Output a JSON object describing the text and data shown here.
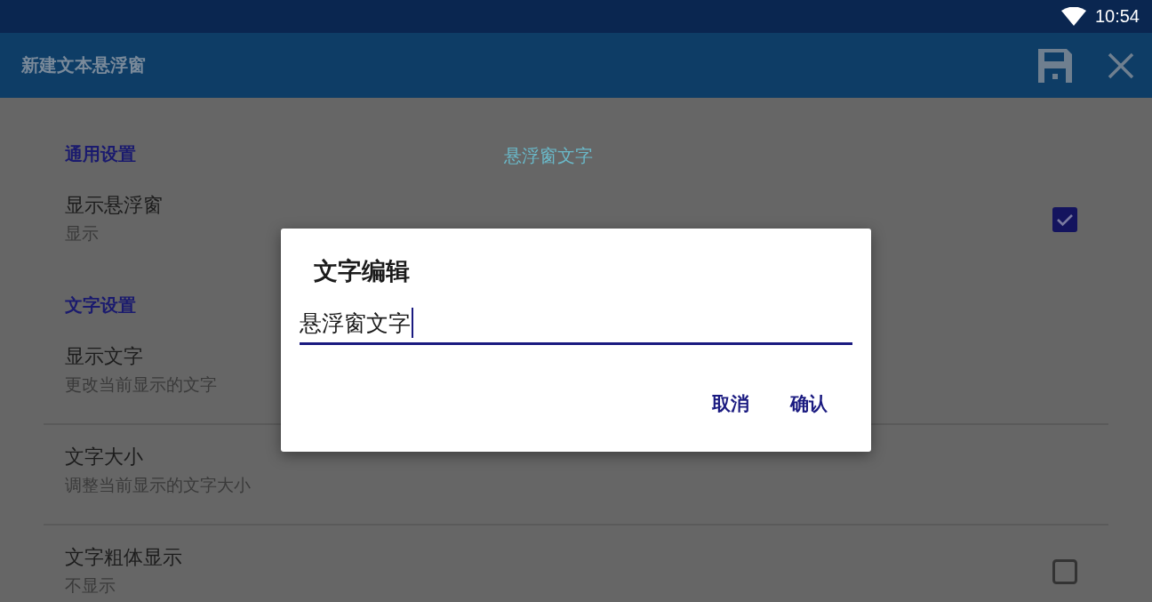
{
  "status_bar": {
    "time": "10:54"
  },
  "app_bar": {
    "title": "新建文本悬浮窗"
  },
  "preview_text": "悬浮窗文字",
  "sections": [
    {
      "header": "通用设置",
      "items": [
        {
          "kind": "checkbox",
          "title": "显示悬浮窗",
          "summary": "显示",
          "checked": true
        }
      ]
    },
    {
      "header": "文字设置",
      "items": [
        {
          "kind": "plain",
          "title": "显示文字",
          "summary": "更改当前显示的文字"
        },
        {
          "kind": "plain",
          "title": "文字大小",
          "summary": "调整当前显示的文字大小"
        },
        {
          "kind": "checkbox",
          "title": "文字粗体显示",
          "summary": "不显示",
          "checked": false
        }
      ]
    }
  ],
  "dialog": {
    "title": "文字编辑",
    "input": {
      "value": "悬浮窗文字"
    },
    "buttons": [
      "取消",
      "确认"
    ]
  }
}
